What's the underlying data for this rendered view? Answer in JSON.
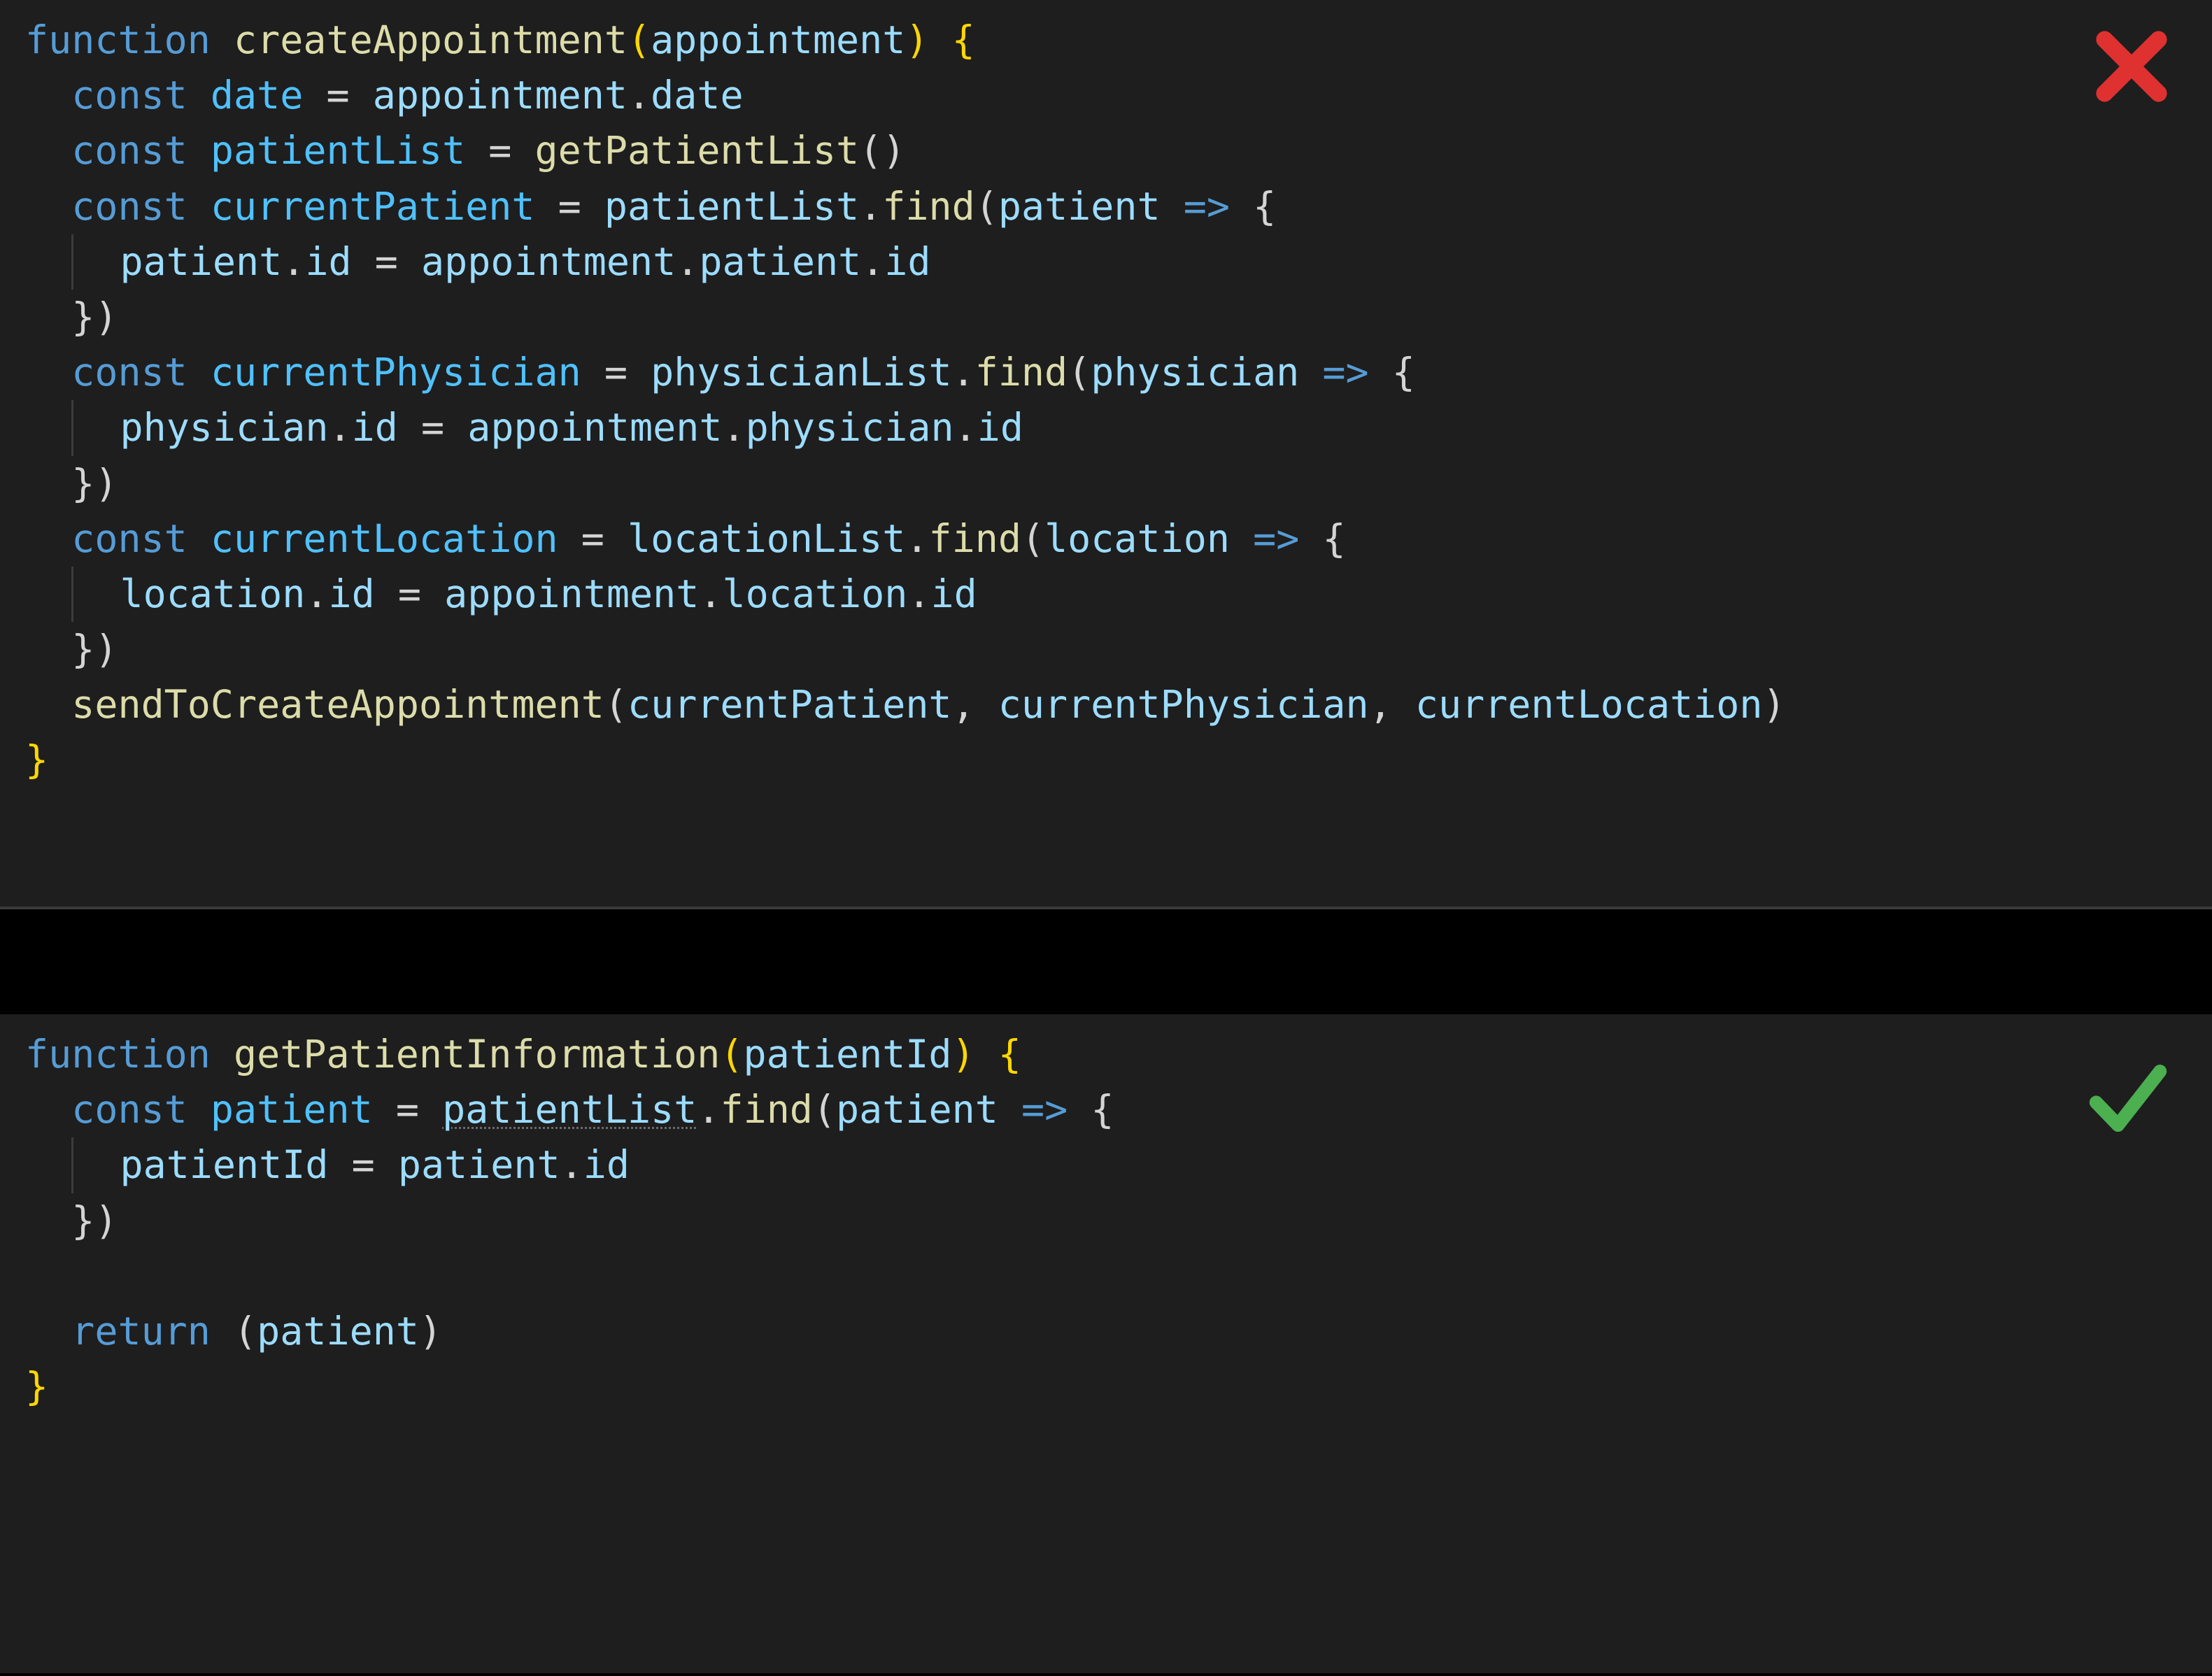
{
  "colors": {
    "background": "#1e1e1e",
    "keyword": "#569cd6",
    "functionName": "#dcdcaa",
    "variable": "#9cdcfe",
    "constName": "#4fc1ff",
    "punctuation": "#d4d4d4",
    "braceHighlight": "#ffd602",
    "crossRed": "#e03131",
    "checkGreen": "#4caf50"
  },
  "topSnippet": {
    "status": "bad",
    "lines": [
      [
        {
          "t": "function ",
          "c": "kw"
        },
        {
          "t": "createAppointment",
          "c": "fn"
        },
        {
          "t": "(",
          "c": "brace"
        },
        {
          "t": "appointment",
          "c": "param"
        },
        {
          "t": ")",
          "c": "brace"
        },
        {
          "t": " ",
          "c": "text"
        },
        {
          "t": "{",
          "c": "brace"
        }
      ],
      [
        {
          "t": "  ",
          "c": "text"
        },
        {
          "t": "const ",
          "c": "kw"
        },
        {
          "t": "date",
          "c": "const"
        },
        {
          "t": " ",
          "c": "text"
        },
        {
          "t": "=",
          "c": "op"
        },
        {
          "t": " ",
          "c": "text"
        },
        {
          "t": "appointment",
          "c": "param"
        },
        {
          "t": ".",
          "c": "punc"
        },
        {
          "t": "date",
          "c": "prop"
        }
      ],
      [
        {
          "t": "  ",
          "c": "text"
        },
        {
          "t": "const ",
          "c": "kw"
        },
        {
          "t": "patientList",
          "c": "const"
        },
        {
          "t": " ",
          "c": "text"
        },
        {
          "t": "=",
          "c": "op"
        },
        {
          "t": " ",
          "c": "text"
        },
        {
          "t": "getPatientList",
          "c": "fn"
        },
        {
          "t": "()",
          "c": "punc"
        }
      ],
      [
        {
          "t": "  ",
          "c": "text"
        },
        {
          "t": "const ",
          "c": "kw"
        },
        {
          "t": "currentPatient",
          "c": "const"
        },
        {
          "t": " ",
          "c": "text"
        },
        {
          "t": "=",
          "c": "op"
        },
        {
          "t": " ",
          "c": "text"
        },
        {
          "t": "patientList",
          "c": "param"
        },
        {
          "t": ".",
          "c": "punc"
        },
        {
          "t": "find",
          "c": "fn"
        },
        {
          "t": "(",
          "c": "punc"
        },
        {
          "t": "patient",
          "c": "param"
        },
        {
          "t": " ",
          "c": "text"
        },
        {
          "t": "=>",
          "c": "kw"
        },
        {
          "t": " ",
          "c": "text"
        },
        {
          "t": "{",
          "c": "punc"
        }
      ],
      [
        {
          "t": "    ",
          "c": "text"
        },
        {
          "t": "patient",
          "c": "param"
        },
        {
          "t": ".",
          "c": "punc"
        },
        {
          "t": "id",
          "c": "prop"
        },
        {
          "t": " ",
          "c": "text"
        },
        {
          "t": "=",
          "c": "op"
        },
        {
          "t": " ",
          "c": "text"
        },
        {
          "t": "appointment",
          "c": "param"
        },
        {
          "t": ".",
          "c": "punc"
        },
        {
          "t": "patient",
          "c": "prop"
        },
        {
          "t": ".",
          "c": "punc"
        },
        {
          "t": "id",
          "c": "prop"
        }
      ],
      [
        {
          "t": "  ",
          "c": "text"
        },
        {
          "t": "})",
          "c": "punc"
        }
      ],
      [
        {
          "t": "  ",
          "c": "text"
        },
        {
          "t": "const ",
          "c": "kw"
        },
        {
          "t": "currentPhysician",
          "c": "const"
        },
        {
          "t": " ",
          "c": "text"
        },
        {
          "t": "=",
          "c": "op"
        },
        {
          "t": " ",
          "c": "text"
        },
        {
          "t": "physicianList",
          "c": "param"
        },
        {
          "t": ".",
          "c": "punc"
        },
        {
          "t": "find",
          "c": "fn"
        },
        {
          "t": "(",
          "c": "punc"
        },
        {
          "t": "physician",
          "c": "param"
        },
        {
          "t": " ",
          "c": "text"
        },
        {
          "t": "=>",
          "c": "kw"
        },
        {
          "t": " ",
          "c": "text"
        },
        {
          "t": "{",
          "c": "punc"
        }
      ],
      [
        {
          "t": "    ",
          "c": "text"
        },
        {
          "t": "physician",
          "c": "param"
        },
        {
          "t": ".",
          "c": "punc"
        },
        {
          "t": "id",
          "c": "prop"
        },
        {
          "t": " ",
          "c": "text"
        },
        {
          "t": "=",
          "c": "op"
        },
        {
          "t": " ",
          "c": "text"
        },
        {
          "t": "appointment",
          "c": "param"
        },
        {
          "t": ".",
          "c": "punc"
        },
        {
          "t": "physician",
          "c": "prop"
        },
        {
          "t": ".",
          "c": "punc"
        },
        {
          "t": "id",
          "c": "prop"
        }
      ],
      [
        {
          "t": "  ",
          "c": "text"
        },
        {
          "t": "})",
          "c": "punc"
        }
      ],
      [
        {
          "t": "  ",
          "c": "text"
        },
        {
          "t": "const ",
          "c": "kw"
        },
        {
          "t": "currentLocation",
          "c": "const"
        },
        {
          "t": " ",
          "c": "text"
        },
        {
          "t": "=",
          "c": "op"
        },
        {
          "t": " ",
          "c": "text"
        },
        {
          "t": "locationList",
          "c": "param"
        },
        {
          "t": ".",
          "c": "punc"
        },
        {
          "t": "find",
          "c": "fn"
        },
        {
          "t": "(",
          "c": "punc"
        },
        {
          "t": "location",
          "c": "param"
        },
        {
          "t": " ",
          "c": "text"
        },
        {
          "t": "=>",
          "c": "kw"
        },
        {
          "t": " ",
          "c": "text"
        },
        {
          "t": "{",
          "c": "punc"
        }
      ],
      [
        {
          "t": "    ",
          "c": "text"
        },
        {
          "t": "location",
          "c": "param"
        },
        {
          "t": ".",
          "c": "punc"
        },
        {
          "t": "id",
          "c": "prop"
        },
        {
          "t": " ",
          "c": "text"
        },
        {
          "t": "=",
          "c": "op"
        },
        {
          "t": " ",
          "c": "text"
        },
        {
          "t": "appointment",
          "c": "param"
        },
        {
          "t": ".",
          "c": "punc"
        },
        {
          "t": "location",
          "c": "prop"
        },
        {
          "t": ".",
          "c": "punc"
        },
        {
          "t": "id",
          "c": "prop"
        }
      ],
      [
        {
          "t": "  ",
          "c": "text"
        },
        {
          "t": "})",
          "c": "punc"
        }
      ],
      [
        {
          "t": "  ",
          "c": "text"
        },
        {
          "t": "sendToCreateAppointment",
          "c": "fn"
        },
        {
          "t": "(",
          "c": "punc"
        },
        {
          "t": "currentPatient",
          "c": "param"
        },
        {
          "t": ", ",
          "c": "punc"
        },
        {
          "t": "currentPhysician",
          "c": "param"
        },
        {
          "t": ", ",
          "c": "punc"
        },
        {
          "t": "currentLocation",
          "c": "param"
        },
        {
          "t": ")",
          "c": "punc"
        }
      ],
      [
        {
          "t": "}",
          "c": "brace"
        }
      ]
    ]
  },
  "bottomSnippet": {
    "status": "good",
    "lines": [
      [
        {
          "t": "function ",
          "c": "kw"
        },
        {
          "t": "getPatientInformation",
          "c": "fn"
        },
        {
          "t": "(",
          "c": "brace"
        },
        {
          "t": "patientId",
          "c": "param"
        },
        {
          "t": ")",
          "c": "brace"
        },
        {
          "t": " ",
          "c": "text"
        },
        {
          "t": "{",
          "c": "brace"
        }
      ],
      [
        {
          "t": "  ",
          "c": "text"
        },
        {
          "t": "const ",
          "c": "kw"
        },
        {
          "t": "patient",
          "c": "const"
        },
        {
          "t": " ",
          "c": "text"
        },
        {
          "t": "=",
          "c": "op"
        },
        {
          "t": " ",
          "c": "text"
        },
        {
          "t": "patientList",
          "c": "param",
          "u": true
        },
        {
          "t": ".",
          "c": "punc"
        },
        {
          "t": "find",
          "c": "fn"
        },
        {
          "t": "(",
          "c": "punc"
        },
        {
          "t": "patient",
          "c": "param"
        },
        {
          "t": " ",
          "c": "text"
        },
        {
          "t": "=>",
          "c": "kw"
        },
        {
          "t": " ",
          "c": "text"
        },
        {
          "t": "{",
          "c": "punc"
        }
      ],
      [
        {
          "t": "    ",
          "c": "text"
        },
        {
          "t": "patientId",
          "c": "param"
        },
        {
          "t": " ",
          "c": "text"
        },
        {
          "t": "=",
          "c": "op"
        },
        {
          "t": " ",
          "c": "text"
        },
        {
          "t": "patient",
          "c": "param"
        },
        {
          "t": ".",
          "c": "punc"
        },
        {
          "t": "id",
          "c": "prop"
        }
      ],
      [
        {
          "t": "  ",
          "c": "text"
        },
        {
          "t": "})",
          "c": "punc"
        }
      ],
      [
        {
          "t": " ",
          "c": "text"
        }
      ],
      [
        {
          "t": "  ",
          "c": "text"
        },
        {
          "t": "return ",
          "c": "kw"
        },
        {
          "t": "(",
          "c": "punc"
        },
        {
          "t": "patient",
          "c": "param"
        },
        {
          "t": ")",
          "c": "punc"
        }
      ],
      [
        {
          "t": "}",
          "c": "brace"
        }
      ]
    ]
  }
}
